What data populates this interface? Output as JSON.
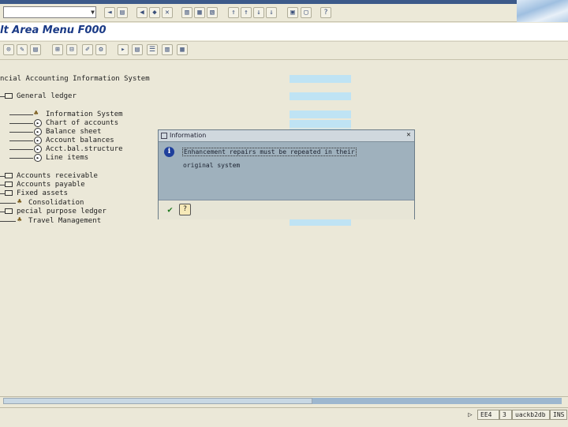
{
  "window": {
    "title": "lt Area Menu F000"
  },
  "tree": {
    "root_label": "ncial Accounting Information System",
    "nodes": [
      {
        "label": "General ledger"
      },
      {
        "label": "Information System"
      },
      {
        "label": "Chart of accounts"
      },
      {
        "label": "Balance sheet"
      },
      {
        "label": "Account balances"
      },
      {
        "label": "Acct.bal.structure"
      },
      {
        "label": "Line items"
      },
      {
        "label": "Accounts receivable"
      },
      {
        "label": "Accounts payable"
      },
      {
        "label": "Fixed assets"
      },
      {
        "label": "Consolidation"
      },
      {
        "label": "pecial purpose ledger"
      },
      {
        "label": "Travel Management"
      }
    ]
  },
  "dialog": {
    "title": "Information",
    "message_line1": "Enhancement repairs must be repeated in their",
    "message_line2": "original system",
    "ok_icon": "checkmark-icon",
    "help_icon": "help-icon"
  },
  "status": {
    "system": "EE4",
    "client": "3",
    "server": "uackb2db",
    "mode": "INS"
  },
  "colors": {
    "title": "#1a3a86",
    "dialog_body": "#9fb1bd",
    "highlight_band": "#bfe3f4"
  }
}
